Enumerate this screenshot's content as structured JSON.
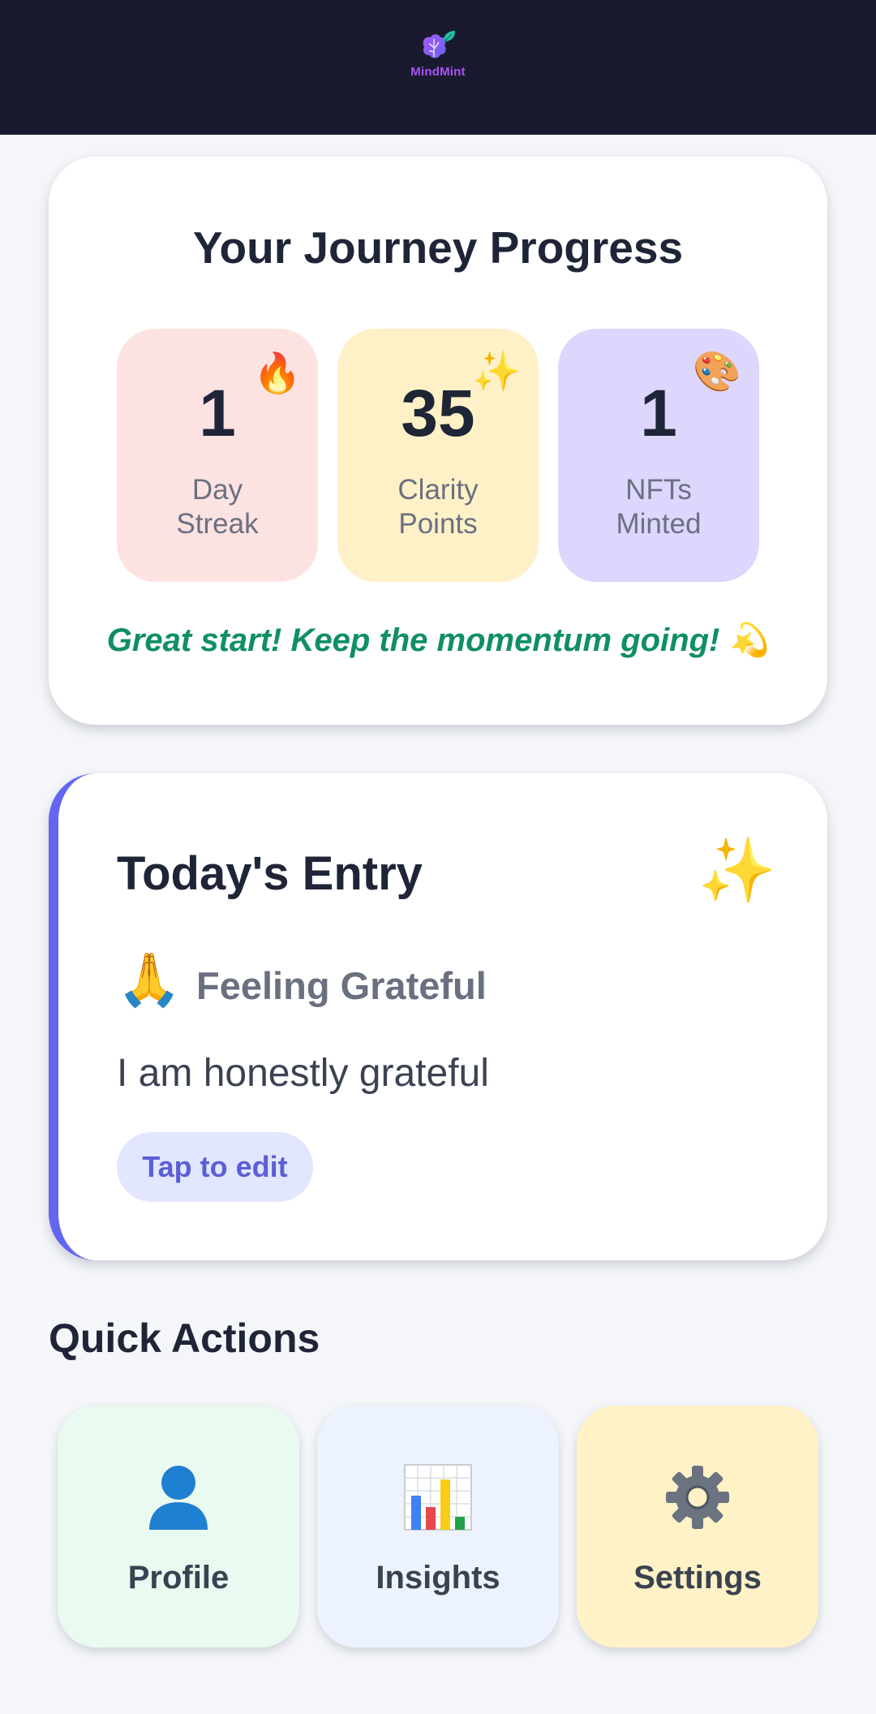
{
  "app": {
    "name": "MindMint"
  },
  "progress": {
    "title": "Your Journey Progress",
    "stats": [
      {
        "value": "1",
        "label": "Day Streak",
        "emoji": "🔥",
        "icon": "fire-icon"
      },
      {
        "value": "35",
        "label": "Clarity Points",
        "emoji": "✨",
        "icon": "sparkles-icon"
      },
      {
        "value": "1",
        "label": "NFTs Minted",
        "emoji": "🎨",
        "icon": "palette-icon"
      }
    ],
    "message": "Great start! Keep the momentum going! 💫"
  },
  "entry": {
    "title": "Today's Entry",
    "sparkle": "✨",
    "mood_emoji": "🙏",
    "mood_label": "Feeling Grateful",
    "text": "I am honestly grateful",
    "edit_label": "Tap to edit"
  },
  "quick_actions": {
    "title": "Quick Actions",
    "items": [
      {
        "label": "Profile",
        "icon": "user-icon"
      },
      {
        "label": "Insights",
        "icon": "bar-chart-icon"
      },
      {
        "label": "Settings",
        "icon": "gear-icon"
      }
    ]
  },
  "colors": {
    "header_bg": "#1a1a2e",
    "accent": "#6366f1",
    "success_text": "#0f8f63",
    "streak_bg": "#fde2e2",
    "points_bg": "#fef1c7",
    "nfts_bg": "#ddd6fd"
  }
}
